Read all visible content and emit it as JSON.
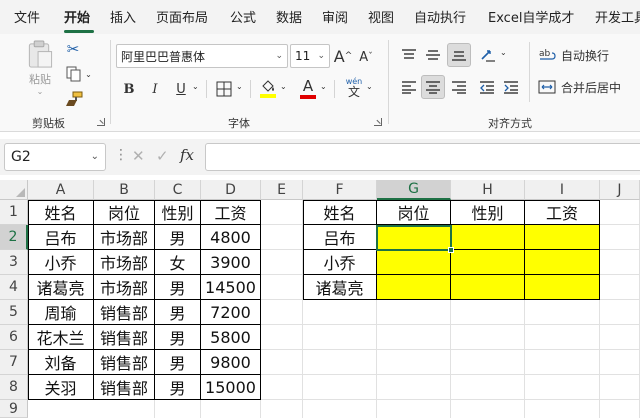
{
  "menu_tabs": [
    "文件",
    "开始",
    "插入",
    "页面布局",
    "公式",
    "数据",
    "审阅",
    "视图",
    "自动执行",
    "Excel自学成才",
    "开发工具"
  ],
  "ribbon": {
    "clipboard": {
      "paste_label": "粘贴",
      "group_label": "剪贴板"
    },
    "font": {
      "font_name": "阿里巴巴普惠体",
      "font_size": "11",
      "grow_label": "A",
      "shrink_label": "A",
      "bold": "B",
      "italic": "I",
      "underline": "U",
      "font_color_letter": "A",
      "highlight_color": "#ffff00",
      "font_color": "#e00000",
      "phonetic_top": "wén",
      "phonetic_bottom": "文",
      "group_label": "字体"
    },
    "alignment": {
      "wrap_text": "自动换行",
      "merge_center": "合并后居中",
      "group_label": "对齐方式"
    }
  },
  "formula_bar": {
    "name_box": "G2",
    "fx_label": "fx",
    "formula": ""
  },
  "grid": {
    "columns": [
      "A",
      "B",
      "C",
      "D",
      "E",
      "F",
      "G",
      "H",
      "I",
      "J"
    ],
    "rows": [
      "1",
      "2",
      "3",
      "4",
      "5",
      "6",
      "7",
      "8",
      "9"
    ],
    "selected_column": "G",
    "selected_row": "2",
    "active_cell": "G2"
  },
  "table1": {
    "headers": [
      "姓名",
      "岗位",
      "性别",
      "工资"
    ],
    "rows": [
      [
        "吕布",
        "市场部",
        "男",
        "4800"
      ],
      [
        "小乔",
        "市场部",
        "女",
        "3900"
      ],
      [
        "诸葛亮",
        "市场部",
        "男",
        "14500"
      ],
      [
        "周瑜",
        "销售部",
        "男",
        "7200"
      ],
      [
        "花木兰",
        "销售部",
        "男",
        "5800"
      ],
      [
        "刘备",
        "销售部",
        "男",
        "9800"
      ],
      [
        "关羽",
        "销售部",
        "男",
        "15000"
      ]
    ]
  },
  "table2": {
    "headers": [
      "姓名",
      "岗位",
      "性别",
      "工资"
    ],
    "names": [
      "吕布",
      "小乔",
      "诸葛亮"
    ],
    "fill_color": "#ffff00"
  },
  "colors": {
    "accent": "#1e7145",
    "highlight": "#ffff00"
  }
}
